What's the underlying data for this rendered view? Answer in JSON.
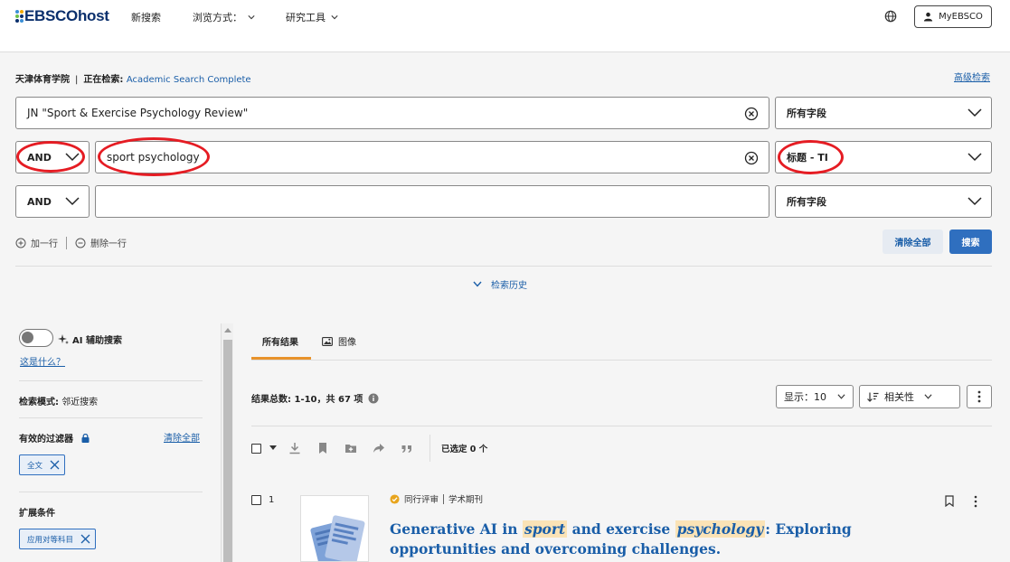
{
  "header": {
    "logo_text": "EBSCOhost",
    "nav": {
      "new_search": "新搜索",
      "browse": "浏览方式：",
      "research_tools": "研究工具"
    },
    "my_ebsco": "MyEBSCO"
  },
  "search": {
    "institution": "天津体育学院",
    "searching_label": "正在检索:",
    "database": "Academic Search Complete",
    "advanced_link": "高级检索",
    "rows": [
      {
        "operator": "",
        "term": "JN \"Sport & Exercise Psychology Review\"",
        "field": "所有字段"
      },
      {
        "operator": "AND",
        "term": "sport psychology",
        "field": "标题 - TI"
      },
      {
        "operator": "AND",
        "term": "",
        "field": "所有字段"
      }
    ],
    "add_row": "加一行",
    "remove_row": "删除一行",
    "clear_all": "清除全部",
    "search_button": "搜索",
    "history": "检索历史"
  },
  "sidebar": {
    "ai_label": "AI 辅助搜索",
    "what_is_this": "这是什么？",
    "search_mode_label": "检索模式:",
    "search_mode_value": "邻近搜索",
    "active_filters": "有效的过滤器",
    "clear_all": "清除全部",
    "filter_chip": "全文",
    "expanders": "扩展条件",
    "expander_chip": "应用对等科目"
  },
  "results": {
    "tabs": [
      "所有结果",
      "图像"
    ],
    "count_label": "结果总数: 1-10，共 67 项",
    "display_select": "显示：10",
    "sort_select": "相关性",
    "selected_count": "已选定 0 个",
    "items": [
      {
        "index": "1",
        "peer_reviewed": "同行评审",
        "type": "学术期刊",
        "title_before": "Generative AI in ",
        "hl1": "sport",
        "title_middle": " and exercise ",
        "hl2": "psychology",
        "title_after": ": Exploring opportunities and overcoming challenges."
      }
    ]
  },
  "colors": {
    "brand_navy": "#0a2f6c",
    "link_blue": "#1a5ea8",
    "primary_button": "#2f6fbf",
    "tab_accent": "#e8932c",
    "annotation_red": "#e51c23",
    "highlight": "#fbe3b6"
  }
}
